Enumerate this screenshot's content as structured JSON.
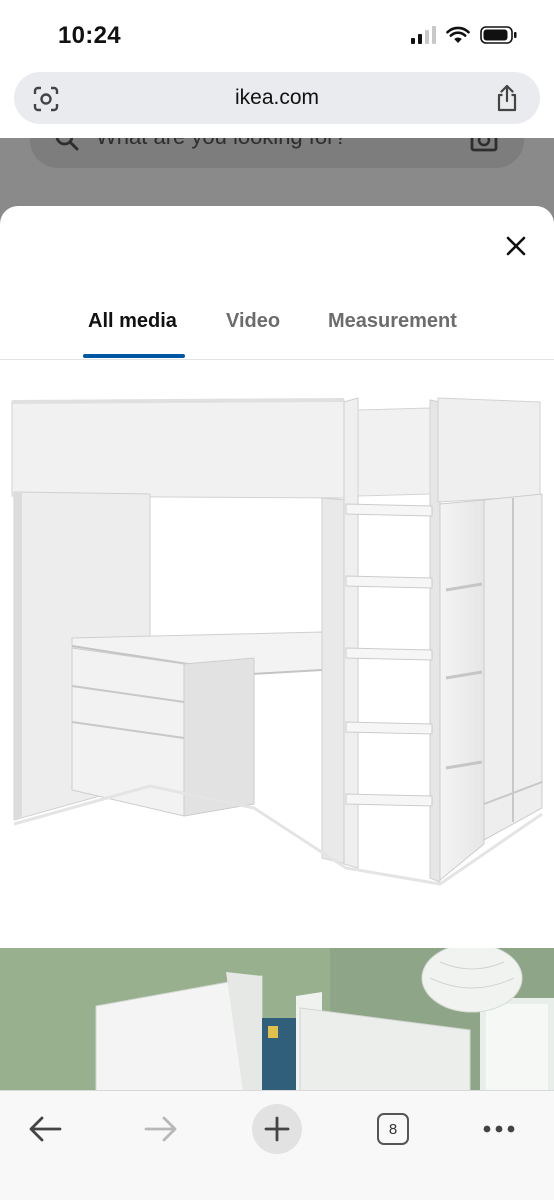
{
  "status_bar": {
    "time": "10:24"
  },
  "browser": {
    "url": "ikea.com",
    "tab_count": "8"
  },
  "background_page": {
    "search_placeholder": "What are you looking for?"
  },
  "media_modal": {
    "tabs": [
      {
        "label": "All media",
        "active": true
      },
      {
        "label": "Video",
        "active": false
      },
      {
        "label": "Measurement",
        "active": false
      }
    ],
    "accent_color": "#0058a3"
  },
  "icons": [
    "lens-icon",
    "share-icon",
    "search-icon",
    "camera-icon",
    "close-icon",
    "back-arrow-icon",
    "forward-arrow-icon",
    "plus-icon",
    "more-icon"
  ]
}
